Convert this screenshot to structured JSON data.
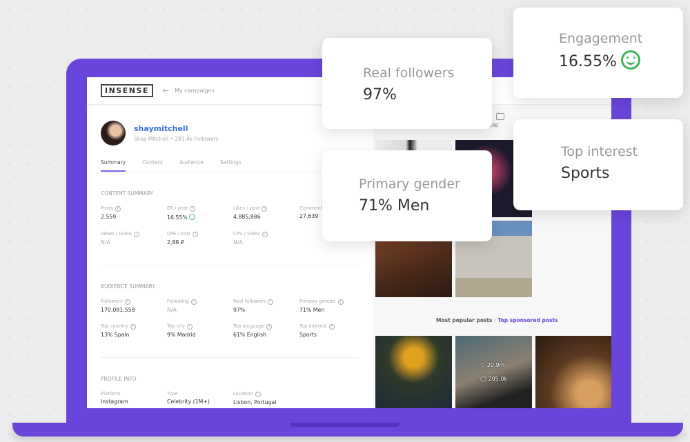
{
  "header": {
    "logo": "INSENSE",
    "back_arrow": "←",
    "back_label": "My campaigns"
  },
  "profile": {
    "username": "shaymitchell",
    "subtitle": "Shay Mitchell • 291.4k Followers"
  },
  "tabs": [
    "Summary",
    "Content",
    "Audience",
    "Settings"
  ],
  "content_summary": {
    "title": "CONTENT SUMMARY",
    "items": [
      {
        "label": "Posts",
        "value": "2,559"
      },
      {
        "label": "ER / post",
        "value": "16.55%"
      },
      {
        "label": "Likes / post",
        "value": "4,885,886"
      },
      {
        "label": "Comments",
        "value": "27,639"
      },
      {
        "label": "Views / video",
        "value": "N/A"
      },
      {
        "label": "CPE / post",
        "value": "2,88 ₽"
      },
      {
        "label": "CPV / video",
        "value": "N/A"
      }
    ]
  },
  "audience_summary": {
    "title": "AUDIENCE SUMMARY",
    "items": [
      {
        "label": "Followers",
        "value": "170,081,558"
      },
      {
        "label": "Following",
        "value": "N/A"
      },
      {
        "label": "Real followers",
        "value": "97%"
      },
      {
        "label": "Primary gender",
        "value": "71% Men"
      },
      {
        "label": "Top country",
        "value": "13% Spain"
      },
      {
        "label": "Top city",
        "value": "9% Madrid"
      },
      {
        "label": "Top language",
        "value": "61% English"
      },
      {
        "label": "Top interest",
        "value": "Sports"
      }
    ]
  },
  "profile_info": {
    "title": "PROFILE INFO",
    "items": [
      {
        "label": "Platform",
        "value": "Instagram"
      },
      {
        "label": "Type",
        "value": "Celebrity (1M+)"
      },
      {
        "label": "Location",
        "value": "Lisbon, Portugal"
      }
    ]
  },
  "portfolio": {
    "label": "Portfolio"
  },
  "posts_tabs": {
    "popular": "Most popular posts",
    "separator": "/",
    "sponsored": "Top sponsored posts"
  },
  "post_stats": {
    "likes": "20,9m",
    "comments": "205,0k"
  },
  "cards": {
    "real_followers": {
      "title": "Real followers",
      "value": "97%"
    },
    "engagement": {
      "title": "Engagement",
      "value": "16.55%"
    },
    "primary_gender": {
      "title": "Primary gender",
      "value": "71% Men"
    },
    "top_interest": {
      "title": "Top interest",
      "value": "Sports"
    }
  },
  "colors": {
    "brand": "#6a45dc",
    "link": "#3a6fd8",
    "positive": "#3cb55a"
  }
}
